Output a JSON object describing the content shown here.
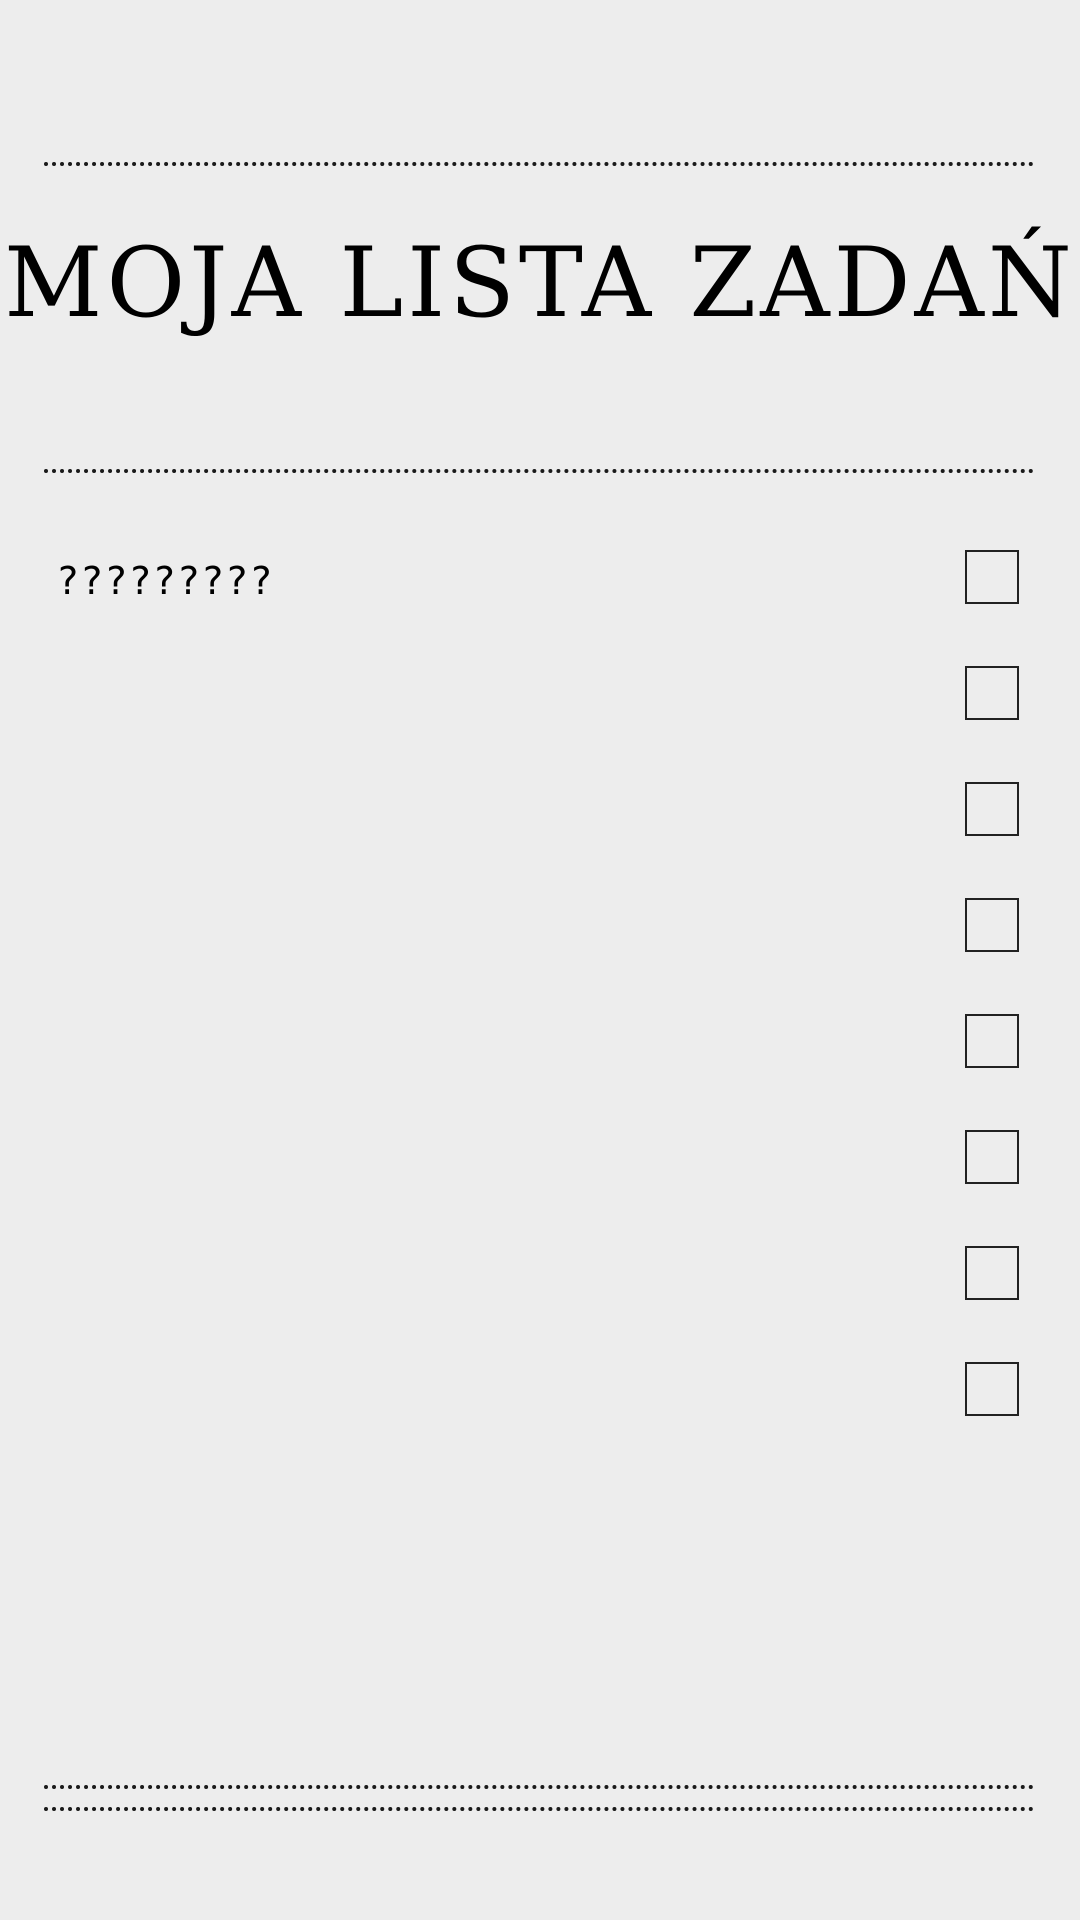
{
  "title": "MOJA LISTA ZADAŃ",
  "tasks": [
    {
      "text": "?????????",
      "checked": false
    },
    {
      "text": "",
      "checked": false
    },
    {
      "text": "",
      "checked": false
    },
    {
      "text": "",
      "checked": false
    },
    {
      "text": "",
      "checked": false
    },
    {
      "text": "",
      "checked": false
    },
    {
      "text": "",
      "checked": false
    },
    {
      "text": "",
      "checked": false
    }
  ]
}
